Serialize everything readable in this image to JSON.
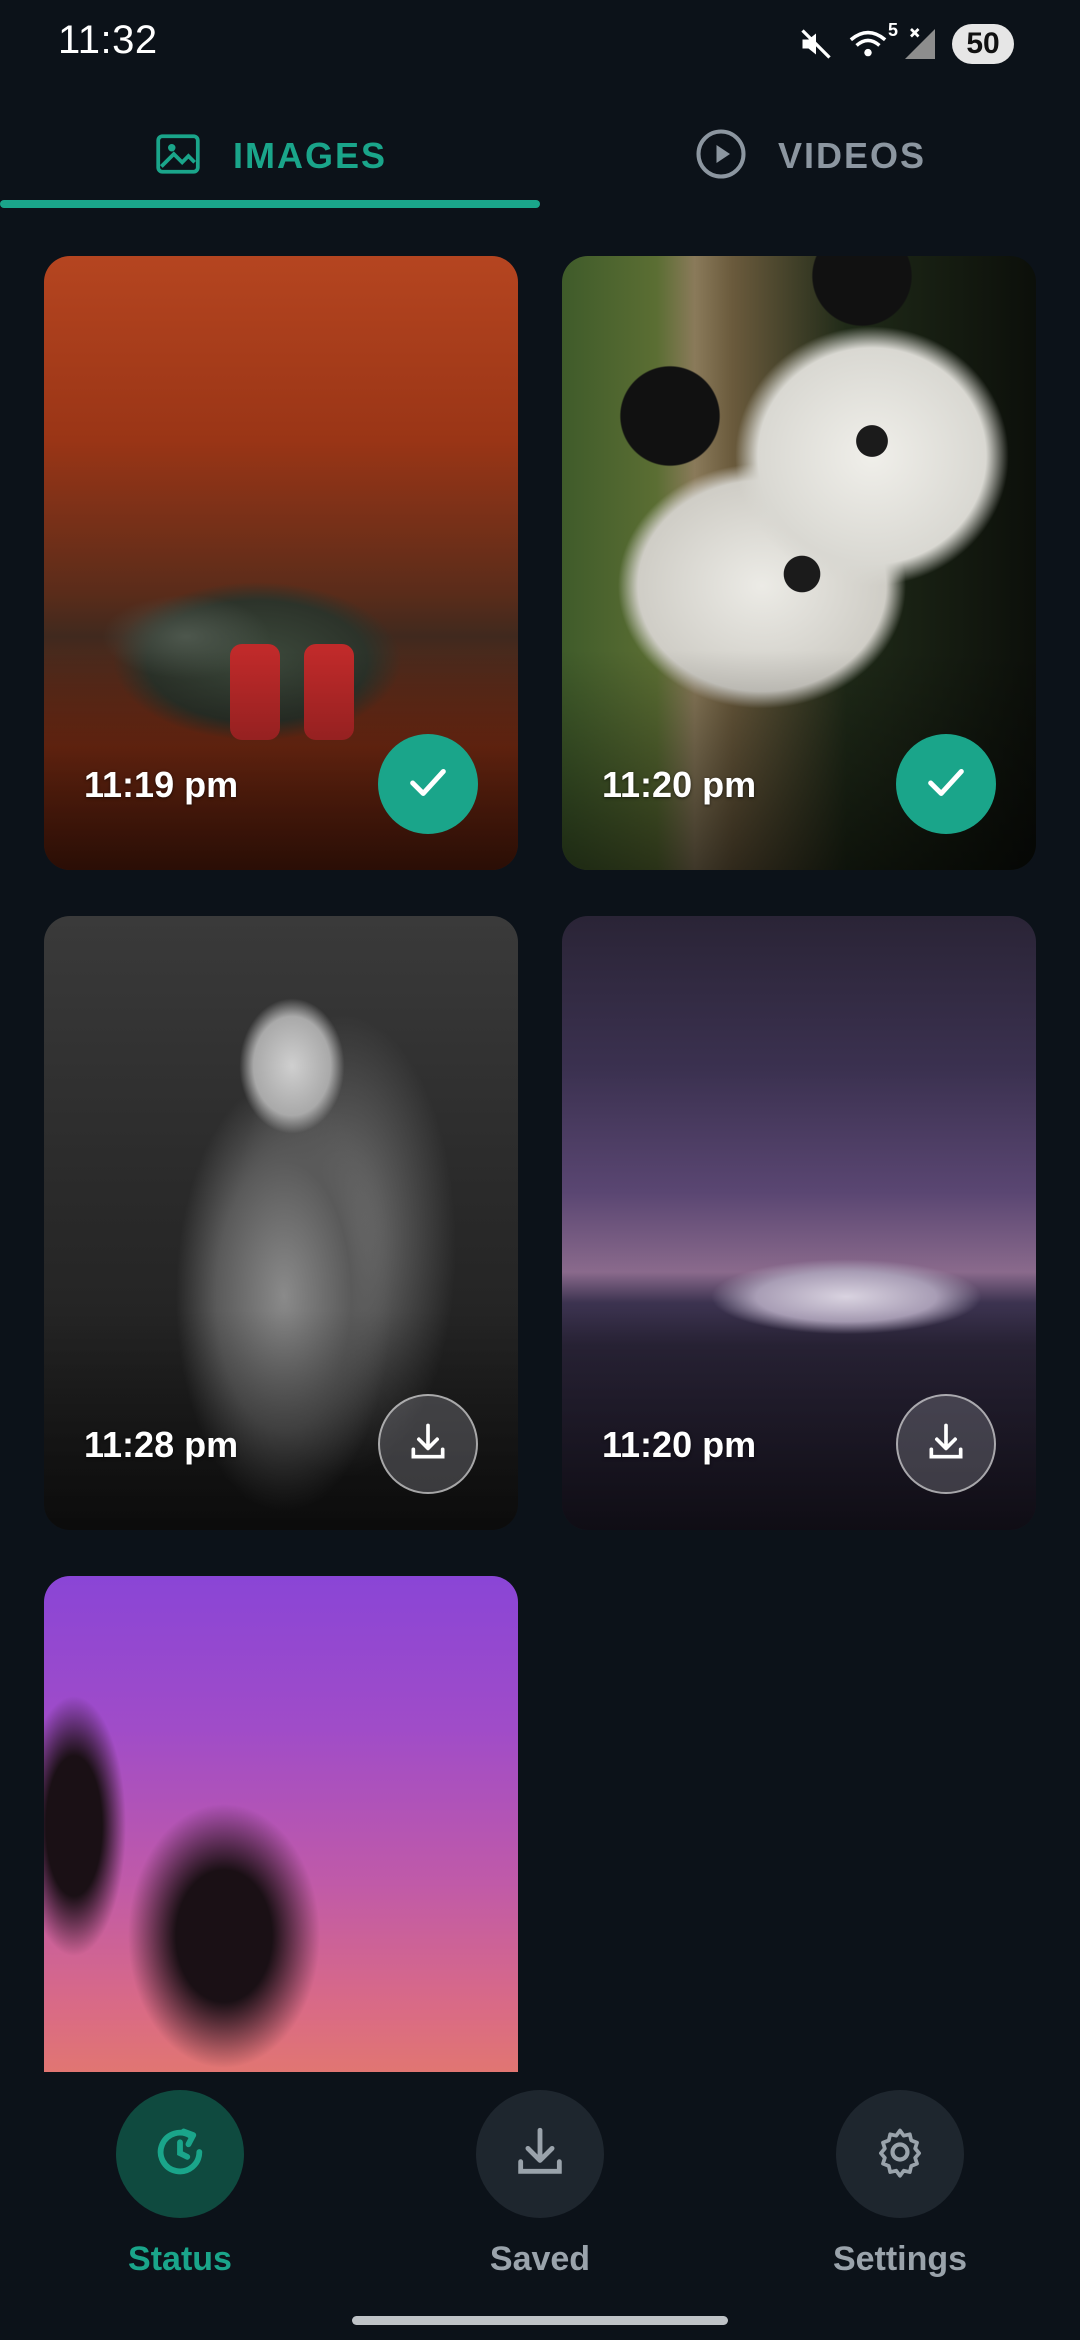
{
  "status_bar": {
    "time": "11:32",
    "wifi_badge": "5",
    "battery": "50",
    "icons": [
      "mute-icon",
      "wifi-icon",
      "signal-icon",
      "battery-icon"
    ]
  },
  "tabs": [
    {
      "label": "IMAGES",
      "icon": "image-icon",
      "selected": true
    },
    {
      "label": "VIDEOS",
      "icon": "play-icon",
      "selected": false
    }
  ],
  "statuses": [
    {
      "time": "11:19 pm",
      "subject": "car",
      "saved": true
    },
    {
      "time": "11:20 pm",
      "subject": "pandas",
      "saved": true
    },
    {
      "time": "11:28 pm",
      "subject": "woman",
      "saved": false
    },
    {
      "time": "11:20 pm",
      "subject": "mountain",
      "saved": false
    },
    {
      "time": "",
      "subject": "palms",
      "saved": false
    }
  ],
  "bottom_nav": [
    {
      "label": "Status",
      "icon": "status-refresh-icon",
      "active": true
    },
    {
      "label": "Saved",
      "icon": "download-icon",
      "active": false
    },
    {
      "label": "Settings",
      "icon": "gear-icon",
      "active": false
    }
  ],
  "colors": {
    "accent": "#1aa58a",
    "background": "#0c1219",
    "inactive_text": "#9aa3ab"
  }
}
